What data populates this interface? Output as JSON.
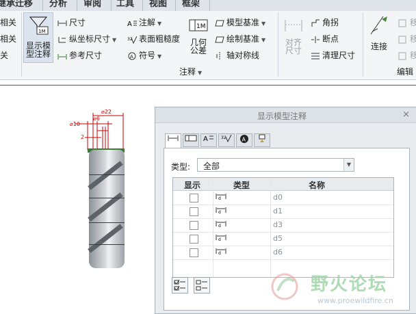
{
  "tabs": [
    {
      "label": "继承迁移"
    },
    {
      "label": "分析"
    },
    {
      "label": "审阅"
    },
    {
      "label": "工具"
    },
    {
      "label": "视图"
    },
    {
      "label": "框架"
    }
  ],
  "ribbon": {
    "left_items": [
      "相关",
      "相关",
      "关"
    ],
    "show_model_annotations": "显示模\n型注释",
    "dimension_items": [
      "尺寸",
      "纵坐标尺寸",
      "参考尺寸"
    ],
    "annotation_items": [
      "注解",
      "表面粗糙度",
      "符号"
    ],
    "geo_tol_label": "几何\n公差",
    "datum_items": [
      "模型基准",
      "绘制基准",
      "轴对称线"
    ],
    "align_dims_label": "对齐\n尺寸",
    "right_items": [
      "角拐",
      "断点",
      "清理尺寸"
    ],
    "connect_label": "连接",
    "far_right_items": [
      "移",
      "移",
      "移"
    ],
    "group_annotation": "注释",
    "group_edit": "编辑"
  },
  "model_dims": {
    "d22": "⌀22",
    "d10": "⌀10",
    "d6": "⌀6",
    "d2": "2"
  },
  "dialog": {
    "title": "显示模型注释",
    "close": "×",
    "type_label": "类型:",
    "type_value": "全部",
    "columns": [
      "显示",
      "类型",
      "名称"
    ],
    "rows": [
      {
        "name": "d0"
      },
      {
        "name": "d1"
      },
      {
        "name": "d3"
      },
      {
        "name": "d5"
      },
      {
        "name": "d6"
      }
    ]
  },
  "watermark": {
    "brand": "野火论坛",
    "url": "www.proewildfire.cn"
  }
}
